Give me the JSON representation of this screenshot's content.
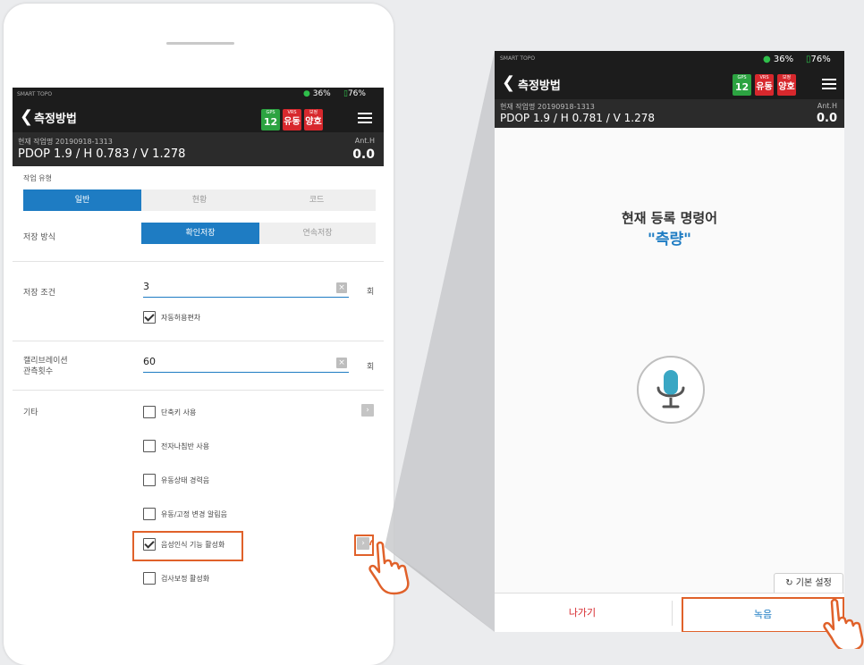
{
  "app": {
    "brand": "SMART TOPO",
    "signal": "36%",
    "battery": "76%",
    "title": "측정방법",
    "gps_label": "GPS",
    "gps_count": "12",
    "vrs_label": "VRS",
    "vrs_status": "유동",
    "fix_label": "보정",
    "fix_status": "양호",
    "job_name_left": "현재 작업명 20190918-1313",
    "job_name_right": "현재 작업명 20190918-1313",
    "pdop_left": "PDOP 1.9 / H 0.783 / V 1.278",
    "pdop_right": "PDOP 1.9 / H 0.781 / V 1.278",
    "anth_label": "Ant.H",
    "anth_value": "0.0"
  },
  "form": {
    "work_type_label": "작업 유형",
    "work_type_tabs": [
      "일반",
      "현황",
      "코드"
    ],
    "save_method_label": "저장 방식",
    "save_method_tabs": [
      "확인저장",
      "연속저장"
    ],
    "save_condition_label": "저장 조건",
    "save_condition_value": "3",
    "save_condition_unit": "회",
    "auto_tolerance_label": "자동허용편차",
    "calibration_label_1": "캘리브레이션",
    "calibration_label_2": "관측횟수",
    "calibration_value": "60",
    "calibration_unit": "회",
    "etc_label": "기타",
    "options": [
      {
        "label": "단축키 사용",
        "checked": false
      },
      {
        "label": "전자나침반 사용",
        "checked": false
      },
      {
        "label": "유동상태 경력음",
        "checked": false
      },
      {
        "label": "유동/고정 변경 알림음",
        "checked": false
      },
      {
        "label": "음성인식 기능 활성화",
        "checked": true
      },
      {
        "label": "검사보정 활성화",
        "checked": false
      }
    ],
    "clear_glyph": "×",
    "arrow_glyph": "›"
  },
  "voice": {
    "current_command_label": "현재 등록 명령어",
    "current_command": "\"측량\"",
    "reset_button": "기본 설정",
    "exit_button": "나가기",
    "record_button": "녹음"
  },
  "colors": {
    "accent": "#1e7cc3",
    "highlight": "#e0612a",
    "gps_green": "#2ca341",
    "status_red": "#d7282d"
  },
  "icons": [
    "back-arrow-icon",
    "menu-icon",
    "checkbox-icon",
    "chevron-right-icon",
    "microphone-icon",
    "refresh-icon",
    "hand-pointer-icon"
  ]
}
